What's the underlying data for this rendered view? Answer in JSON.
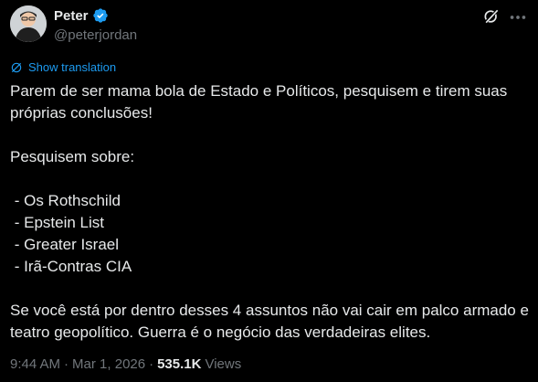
{
  "author": {
    "name": "Peter",
    "handle": "@peterjordan",
    "verified_color": "#1d9bf0"
  },
  "translate_label": "Show translation",
  "tweet": {
    "line1": "Parem de ser mama bola de Estado e Políticos, pesquisem e tirem suas próprias conclusões!",
    "line2": "Pesquisem sobre:",
    "items": [
      " - Os Rothschild",
      " - Epstein List",
      " - Greater Israel",
      " - Irã-Contras CIA"
    ],
    "line3": "Se você está por dentro desses 4 assuntos não vai cair em palco armado e teatro geopolítico. Guerra é o negócio das verdadeiras elites."
  },
  "meta": {
    "time": "9:44 AM",
    "sep": "·",
    "date": "Mar 1, 2026",
    "sep2": "·",
    "views_count": "535.1K",
    "views_label": "Views"
  },
  "icons": [
    "grok-icon",
    "more-icon",
    "verified-badge-icon",
    "translate-icon"
  ]
}
